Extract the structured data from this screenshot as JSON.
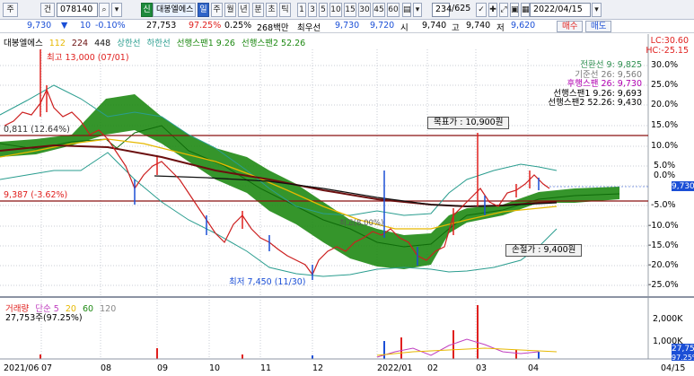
{
  "toolbar": {
    "buttons": [
      "주",
      "건"
    ],
    "stock_code": "078140",
    "credit_badge": "신",
    "stock_name": "대봉엘에스",
    "periods": [
      "일",
      "주",
      "월",
      "년",
      "분",
      "초",
      "틱"
    ],
    "intervals": [
      "1",
      "3",
      "5",
      "10",
      "15",
      "30",
      "45",
      "60"
    ],
    "count_value": "234",
    "count_total": "/625",
    "date": "2022/04/15"
  },
  "info": {
    "price": "9,730",
    "change": "10",
    "change_pct": "-0.10%",
    "volume": "27,753",
    "volume_ratio": "97.25%",
    "turnover": "0.25%",
    "amount": "268백만",
    "best_label": "최우선",
    "best_ask": "9,730",
    "best_bid": "9,720",
    "open_label": "시",
    "open": "9,740",
    "high_label": "고",
    "high": "9,740",
    "low_label": "저",
    "low": "9,620",
    "buy_label": "매수",
    "sell_label": "매도"
  },
  "legend_top": {
    "name": "대봉엘에스",
    "ma1": "112",
    "ma2": "224",
    "ma3": "448",
    "upper": "상한선",
    "lower": "하한선",
    "span1": "선행스팬1 9.26",
    "span2": "선행스팬2 52.26"
  },
  "lc_label": "LC:30.60",
  "hc_label": "HC:-25.15",
  "legend_right": [
    {
      "text": "전환선 9: 9,825",
      "color": "#2f8f50"
    },
    {
      "text": "기준선 26: 9,560",
      "color": "#7a7a7a"
    },
    {
      "text": "후행스팬 26: 9,730",
      "color": "#b000b0"
    },
    {
      "text": "선행스팬1 9.26: 9,693",
      "color": "#000000"
    },
    {
      "text": "선행스팬2 52.26: 9,430",
      "color": "#000000"
    }
  ],
  "annotations": {
    "high_marker": "최고 13,000 (07/01)",
    "low_marker": "최저 7,450 (11/30)",
    "target_price": "목표가  : 10,900원",
    "stop_loss": "손절가  : 9,400원",
    "left_level1": "0,811 (12.64%)",
    "left_level2": "9,387 (-3.62%)",
    "mid_label": "최고(8,00%)"
  },
  "axis": {
    "right_pct": [
      "30.0%",
      "25.0%",
      "20.0%",
      "15.0%",
      "10.0%",
      "5.0%",
      "0.0%",
      "-5.0%",
      "-10.0%",
      "-15.0%",
      "-20.0%",
      "-25.0%"
    ],
    "volume_ticks": [
      "2,000K",
      "1,000K"
    ],
    "current_price_tag": "9,730",
    "current_volume_tag": "27,753",
    "volume_ratio_tag": "97.25%",
    "dates": [
      "2021/06",
      "07",
      "08",
      "09",
      "10",
      "11",
      "12",
      "2022/01",
      "02",
      "03",
      "04",
      "04/15"
    ]
  },
  "volume_legend": {
    "label": "거래량",
    "ma_label": "단순",
    "ma_values": [
      "5",
      "20",
      "60",
      "120"
    ],
    "current": "27,753주(97.25%)"
  },
  "colors": {
    "up": "#e0201e",
    "down": "#1b4fd6",
    "cloud": "#1f8a14",
    "ma_dark": "#6b0f0f",
    "bollinger": "#2a9d8f"
  }
}
